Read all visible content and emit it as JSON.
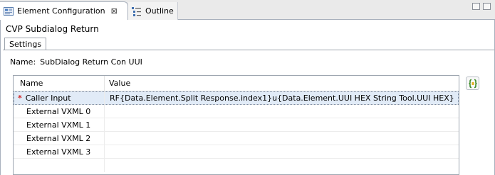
{
  "tabs": [
    {
      "label": "Element Configuration",
      "icon": "element-config-icon",
      "close_icon": "close-icon",
      "active": true
    },
    {
      "label": "Outline",
      "icon": "outline-icon",
      "active": false
    }
  ],
  "close_symbol": "⊠",
  "editor": {
    "title": "CVP Subdialog Return",
    "settings_tab": "Settings",
    "name_label": "Name:",
    "name_value": "SubDialog Return Con UUI"
  },
  "table": {
    "columns": [
      "Name",
      "Value"
    ],
    "rows": [
      {
        "name": "Caller Input",
        "value": "RF{Data.Element.Split Response.index1}u{Data.Element.UUI HEX String Tool.UUI HEX}",
        "required": true,
        "required_mark": "*"
      },
      {
        "name": "External VXML 0",
        "value": ""
      },
      {
        "name": "External VXML 1",
        "value": ""
      },
      {
        "name": "External VXML 2",
        "value": ""
      },
      {
        "name": "External VXML 3",
        "value": ""
      }
    ]
  },
  "side_button_icon": "variable-substitution-icon",
  "colors": {
    "selection": "#e1ebf7",
    "required": "#d21f1f",
    "border": "#a9b1bd"
  }
}
